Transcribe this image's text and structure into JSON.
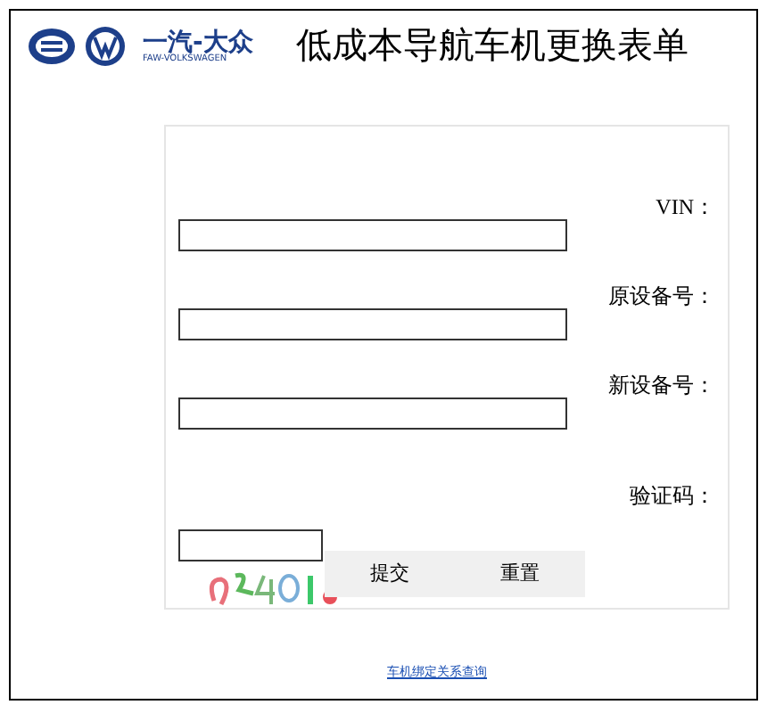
{
  "header": {
    "logo_text": "一汽-大众",
    "logo_subtext": "FAW-VOLKSWAGEN",
    "title": "低成本导航车机更换表单"
  },
  "form": {
    "fields": [
      {
        "label": "VIN："
      },
      {
        "label": "原设备号："
      },
      {
        "label": "新设备号："
      }
    ],
    "captcha": {
      "label": "验证码：",
      "kind": "picture"
    },
    "buttons": [
      "提交",
      "重置"
    ]
  },
  "footer_link": "车机绑定关系查询"
}
